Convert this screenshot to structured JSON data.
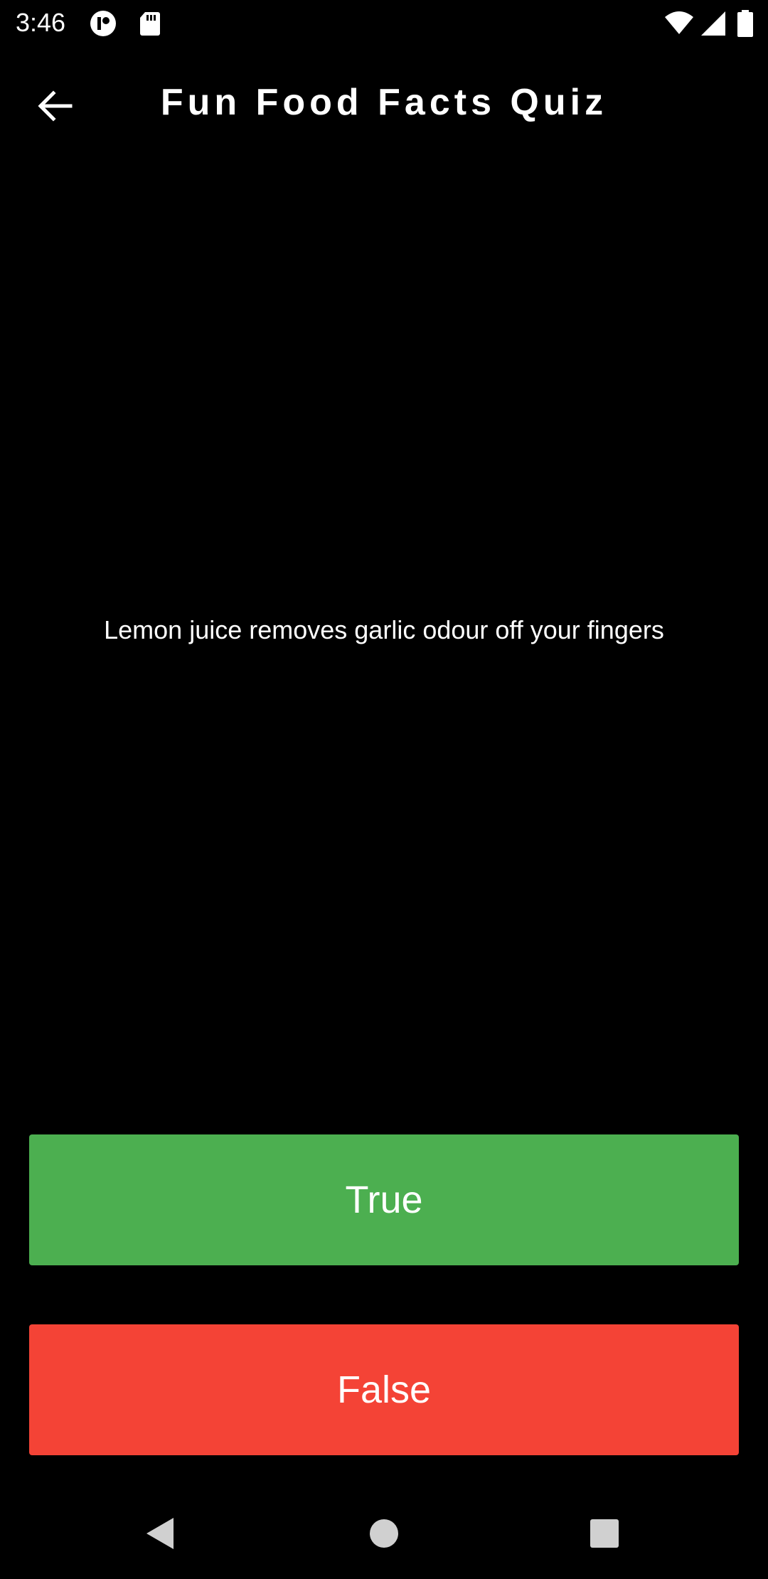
{
  "status_bar": {
    "time": "3:46"
  },
  "app_bar": {
    "title": "Fun Food Facts Quiz",
    "back_icon": "arrow-back-icon"
  },
  "question": {
    "text": "Lemon juice removes garlic odour off your fingers"
  },
  "answers": {
    "true_label": "True",
    "false_label": "False",
    "true_color": "#4caf50",
    "false_color": "#f44336"
  },
  "nav_bar": {
    "back_icon": "nav-back-icon",
    "home_icon": "nav-home-icon",
    "recents_icon": "nav-recents-icon"
  }
}
